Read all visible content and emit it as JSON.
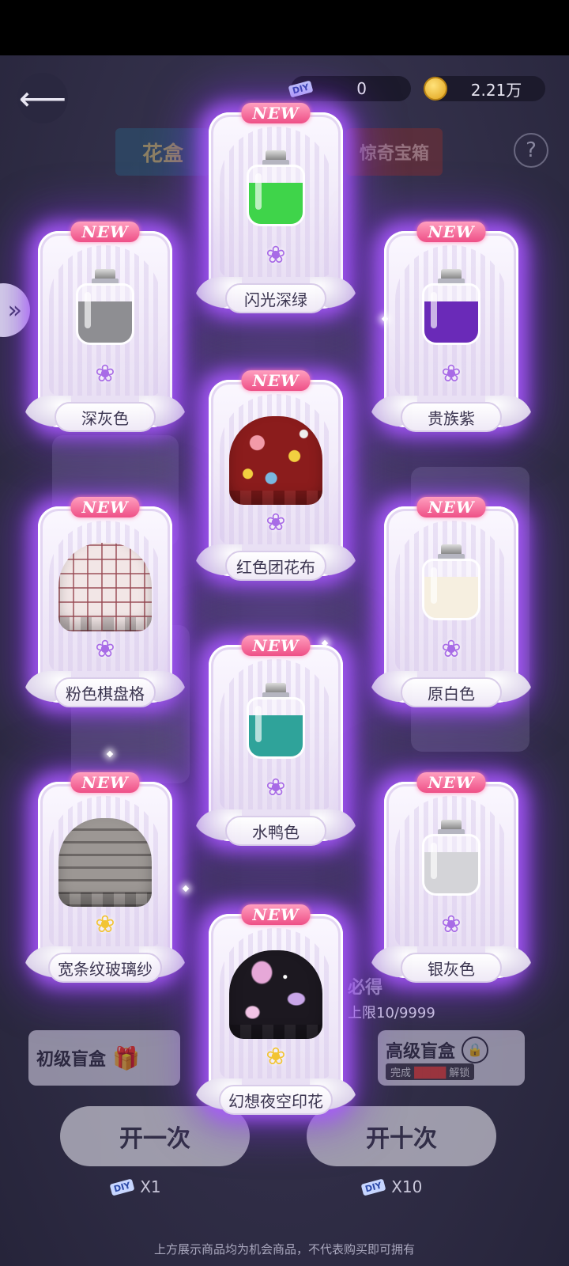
{
  "header": {
    "diy_label": "DIY",
    "diy_amount": "0",
    "coin_amount": "2.21万",
    "tabs": [
      "花盒",
      "惊奇宝箱"
    ],
    "help": "?"
  },
  "background": {
    "limit_text": "上限10/9999",
    "guarantee_text": "必得",
    "basic_box": "初级盲盒",
    "advanced_box": "高级盲盒",
    "unlock_text_prefix": "完成",
    "unlock_text_suffix": "解锁",
    "open_once": "开一次",
    "open_ten": "开十次",
    "cost_once": "X1",
    "cost_ten": "X10",
    "footer": "上方展示商品均为机会商品，不代表购买即可拥有"
  },
  "badge_text": "NEW",
  "rewards": [
    {
      "name": "闪光深绿",
      "kind": "bottle",
      "color": "#3fd44a",
      "rarity": "purple"
    },
    {
      "name": "深灰色",
      "kind": "bottle",
      "color": "#8e8e92",
      "rarity": "purple"
    },
    {
      "name": "贵族紫",
      "kind": "bottle",
      "color": "#6a2ab8",
      "rarity": "purple"
    },
    {
      "name": "红色团花布",
      "kind": "fabric",
      "color": "#8b1c1c",
      "rarity": "purple"
    },
    {
      "name": "粉色棋盘格",
      "kind": "fabric",
      "color": "#f2e6e6",
      "rarity": "purple"
    },
    {
      "name": "原白色",
      "kind": "bottle",
      "color": "#f6efe0",
      "rarity": "purple"
    },
    {
      "name": "水鸭色",
      "kind": "bottle",
      "color": "#2fa39a",
      "rarity": "purple"
    },
    {
      "name": "宽条纹玻璃纱",
      "kind": "fabric",
      "color": "#9c9794",
      "rarity": "gold"
    },
    {
      "name": "银灰色",
      "kind": "bottle",
      "color": "#d4d4d8",
      "rarity": "purple"
    },
    {
      "name": "幻想夜空印花",
      "kind": "fabric",
      "color": "#1c1820",
      "rarity": "gold"
    }
  ]
}
